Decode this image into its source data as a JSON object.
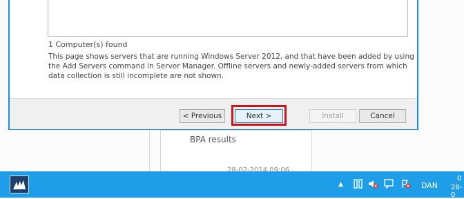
{
  "wizard": {
    "found_text": "1 Computer(s) found",
    "description": "This page shows servers that are running Windows Server 2012, and that have been added by using the Add Servers command in Server Manager. Offline servers and newly-added servers from which data collection is still incomplete are not shown.",
    "buttons": {
      "previous": "< Previous",
      "next": "Next >",
      "install": "Install",
      "cancel": "Cancel"
    }
  },
  "background": {
    "bpa_title": "BPA results",
    "bpa_timestamp": "28-02-2014 09:06"
  },
  "taskbar": {
    "show_hidden_icon": "▲",
    "language": "DAN",
    "clock_line1": "0",
    "clock_line2": "28-0"
  },
  "colors": {
    "taskbar": "#1e9ee8",
    "dialog_border": "#1a8fe0",
    "highlight": "#d0141c"
  },
  "icons": [
    "server-manager-start-icon",
    "network-icon",
    "speaker-muted-icon",
    "notifications-icon",
    "action-center-icon"
  ]
}
